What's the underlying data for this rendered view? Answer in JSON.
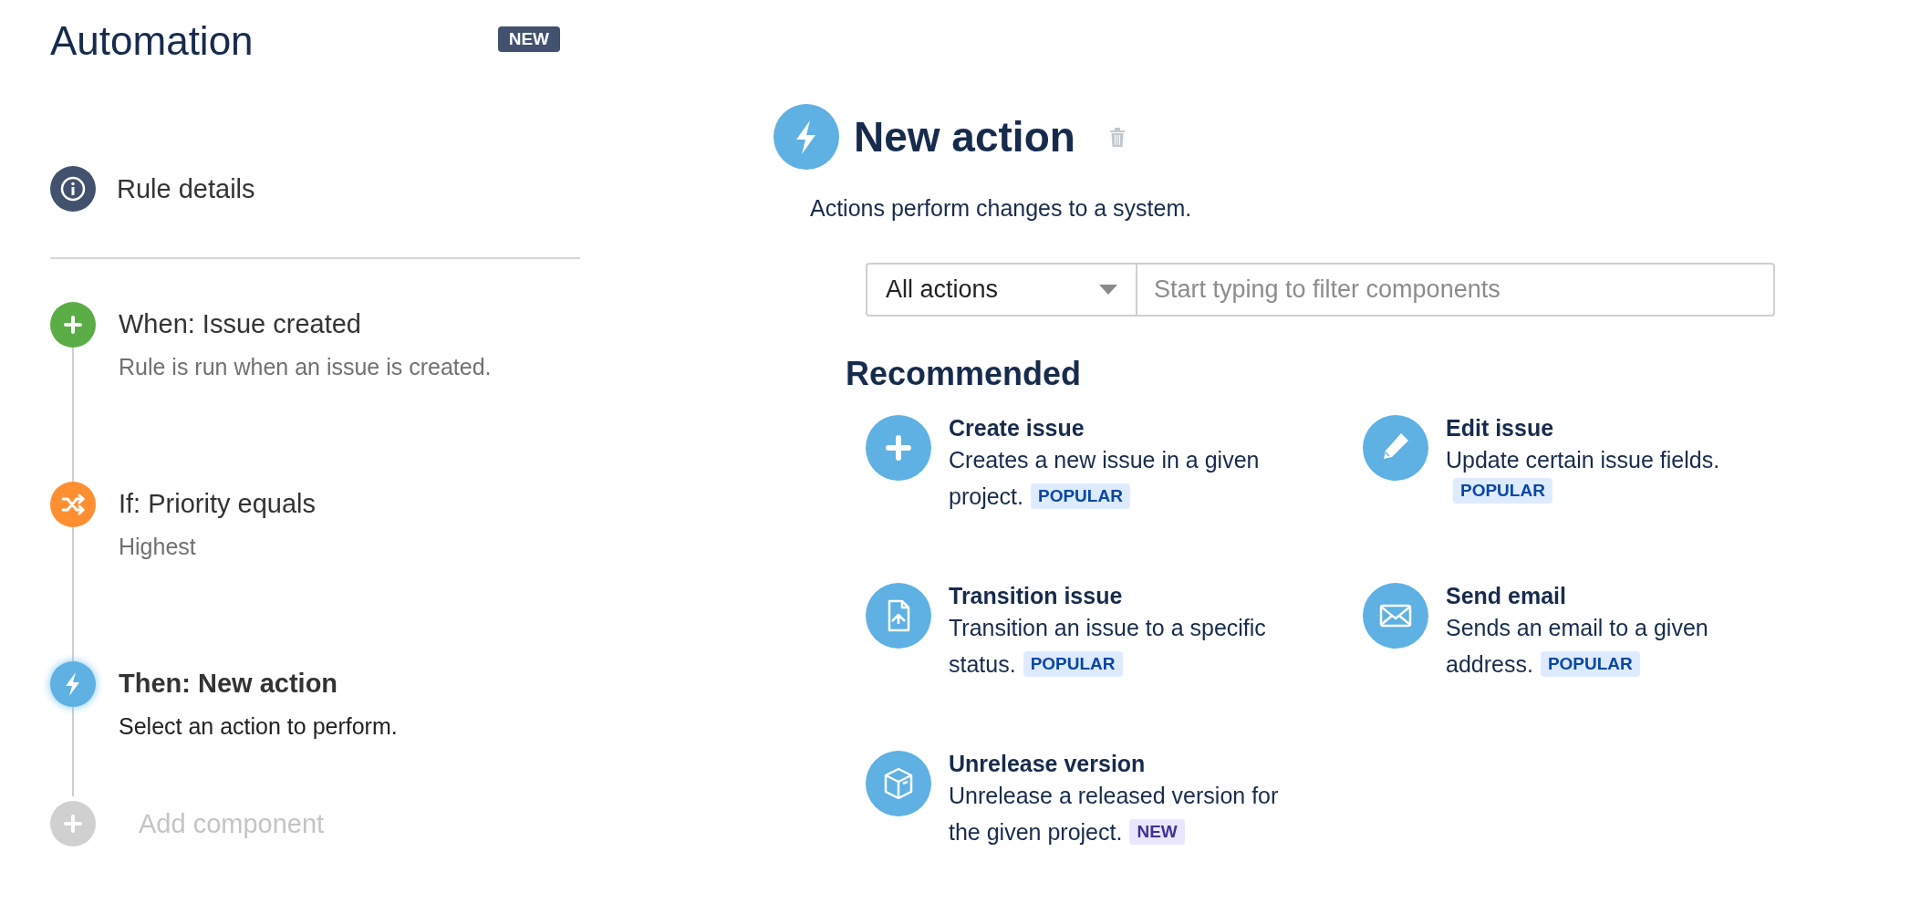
{
  "header": {
    "title": "Automation",
    "badge": "NEW"
  },
  "rule_details": {
    "label": "Rule details"
  },
  "steps": [
    {
      "kind": "trigger",
      "title": "When: Issue created",
      "description": "Rule is run when an issue is created.",
      "selected": false
    },
    {
      "kind": "condition",
      "title": "If: Priority equals",
      "description": "Highest",
      "selected": false
    },
    {
      "kind": "action",
      "title": "Then: New action",
      "description": "Select an action to perform.",
      "selected": true
    }
  ],
  "add_component": {
    "label": "Add component",
    "disabled": true
  },
  "panel": {
    "title": "New action",
    "description": "Actions perform changes to a system.",
    "filter": {
      "dropdown": "All actions",
      "placeholder": "Start typing to filter components"
    },
    "section_title": "Recommended",
    "components": [
      {
        "kind": "create",
        "title": "Create issue",
        "description": [
          "Creates a new issue in a given",
          "project."
        ],
        "tag": {
          "kind": "popular",
          "label": "POPULAR"
        }
      },
      {
        "kind": "edit",
        "title": "Edit issue",
        "description": [
          "Update certain issue fields."
        ],
        "tag": {
          "kind": "popular",
          "label": "POPULAR"
        }
      },
      {
        "kind": "transition",
        "title": "Transition issue",
        "description": [
          "Transition an issue to a specific",
          "status."
        ],
        "tag": {
          "kind": "popular",
          "label": "POPULAR"
        }
      },
      {
        "kind": "email",
        "title": "Send email",
        "description": [
          "Sends an email to a given",
          "address."
        ],
        "tag": {
          "kind": "popular",
          "label": "POPULAR"
        }
      },
      {
        "kind": "release",
        "title": "Unrelease version",
        "description": [
          "Unrelease a released version for",
          "the given project."
        ],
        "tag": {
          "kind": "new",
          "label": "NEW"
        }
      }
    ]
  }
}
